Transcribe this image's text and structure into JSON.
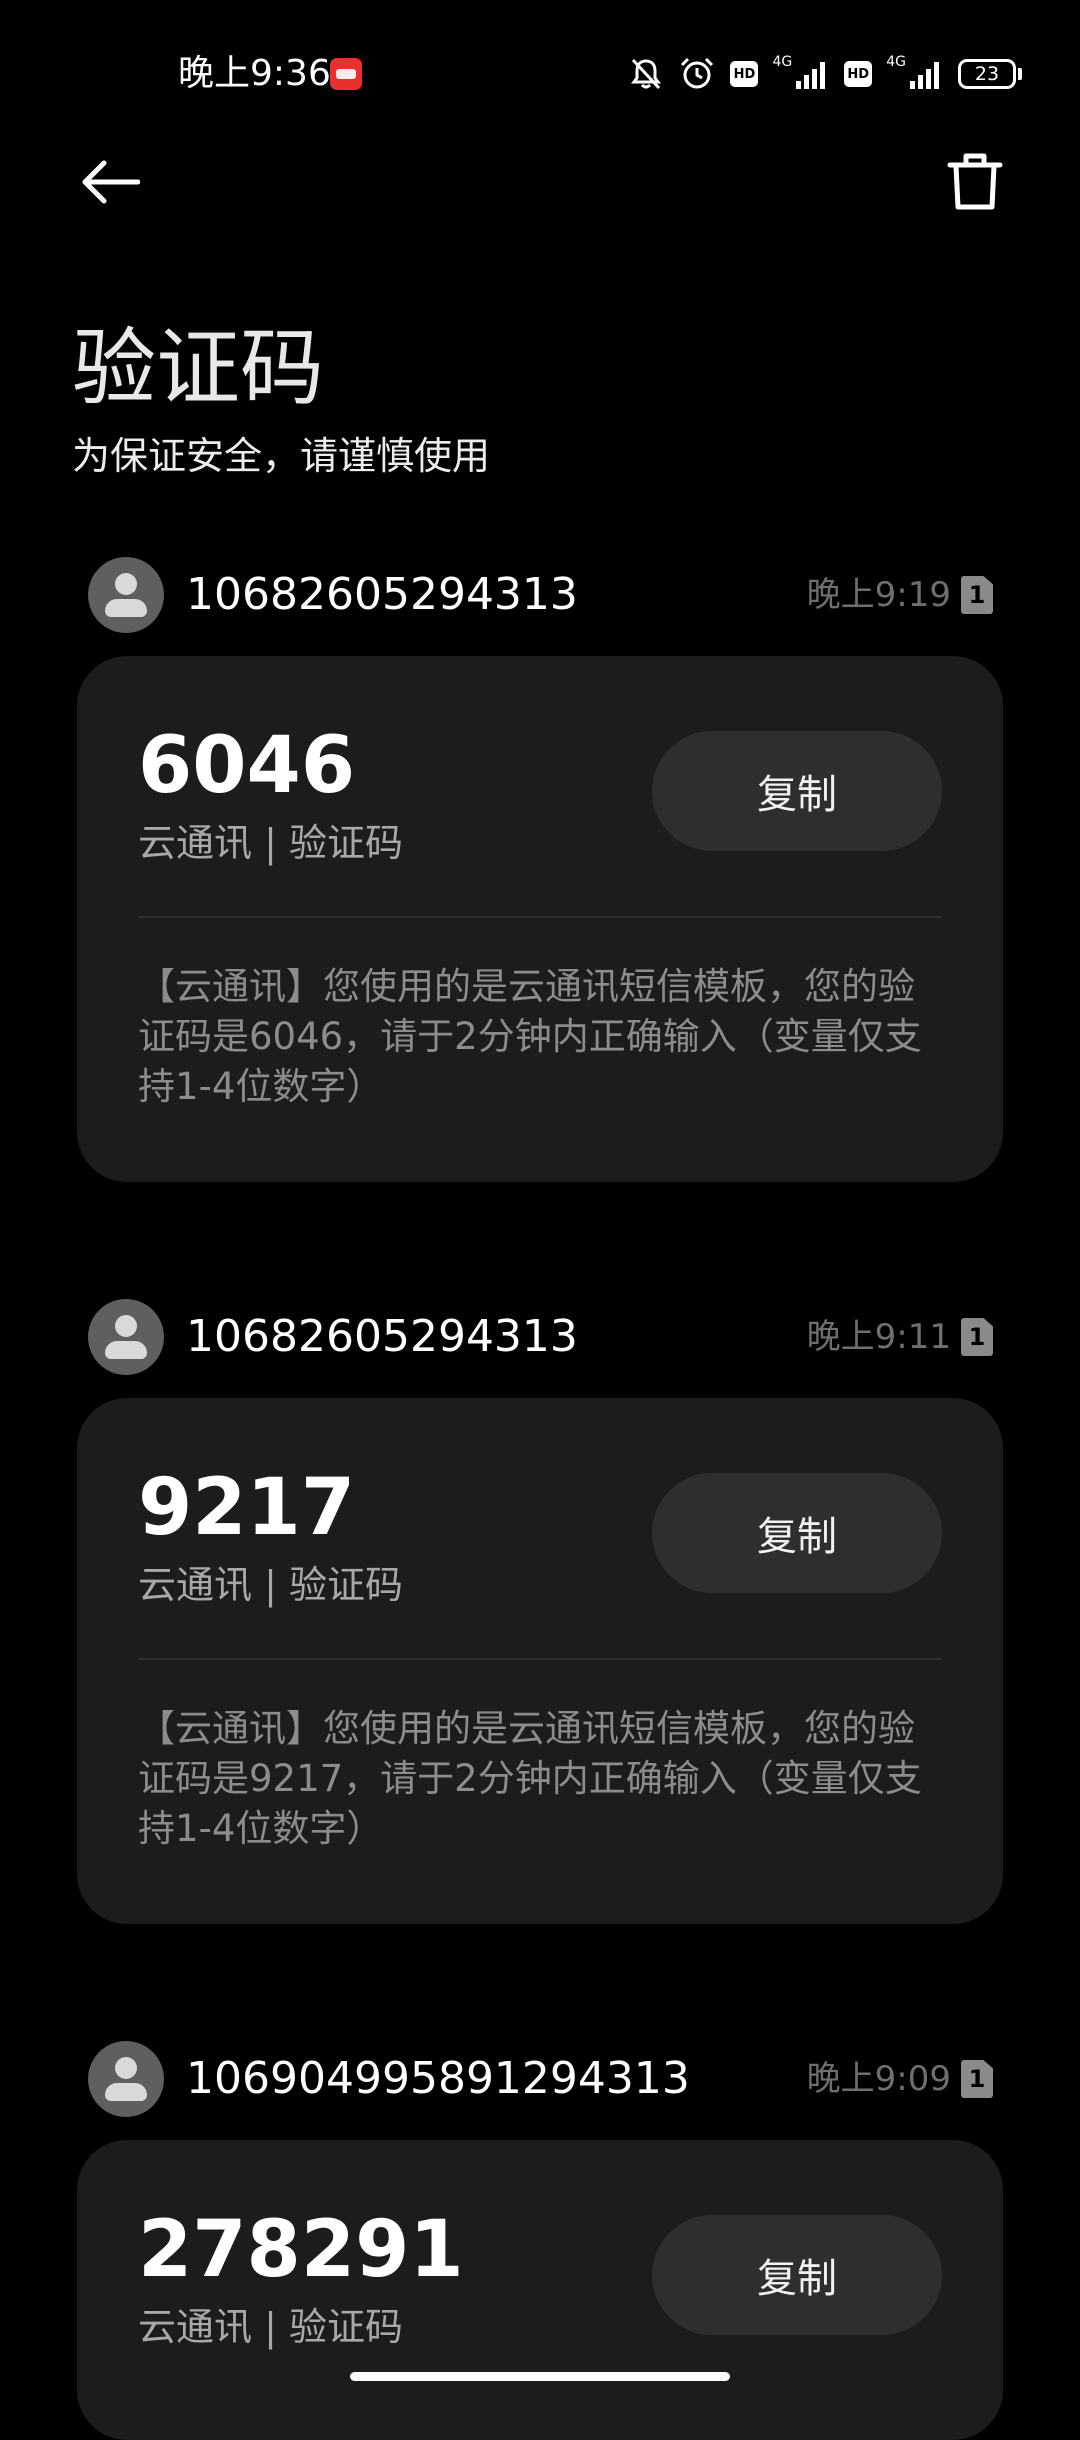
{
  "status_bar": {
    "time": "晚上9:36",
    "network_1": "4G",
    "network_2": "4G",
    "battery": "23"
  },
  "header": {
    "title": "验证码",
    "subtitle": "为保证安全，请谨慎使用"
  },
  "messages": [
    {
      "sender": "10682605294313",
      "time": "晚上9:19",
      "sim": "1",
      "code": "6046",
      "source": "云通讯 | 验证码",
      "copy_label": "复制",
      "body": "【云通讯】您使用的是云通讯短信模板，您的验证码是6046，请于2分钟内正确输入（变量仅支持1-4位数字）"
    },
    {
      "sender": "10682605294313",
      "time": "晚上9:11",
      "sim": "1",
      "code": "9217",
      "source": "云通讯 | 验证码",
      "copy_label": "复制",
      "body": "【云通讯】您使用的是云通讯短信模板，您的验证码是9217，请于2分钟内正确输入（变量仅支持1-4位数字）"
    },
    {
      "sender": "106904995891294313",
      "time": "晚上9:09",
      "sim": "1",
      "code": "278291",
      "source": "云通讯 | 验证码",
      "copy_label": "复制",
      "body": ""
    }
  ],
  "icons": {
    "back": "arrow-left-icon",
    "delete": "trash-icon",
    "mute": "bell-off-icon",
    "alarm": "alarm-clock-icon"
  }
}
